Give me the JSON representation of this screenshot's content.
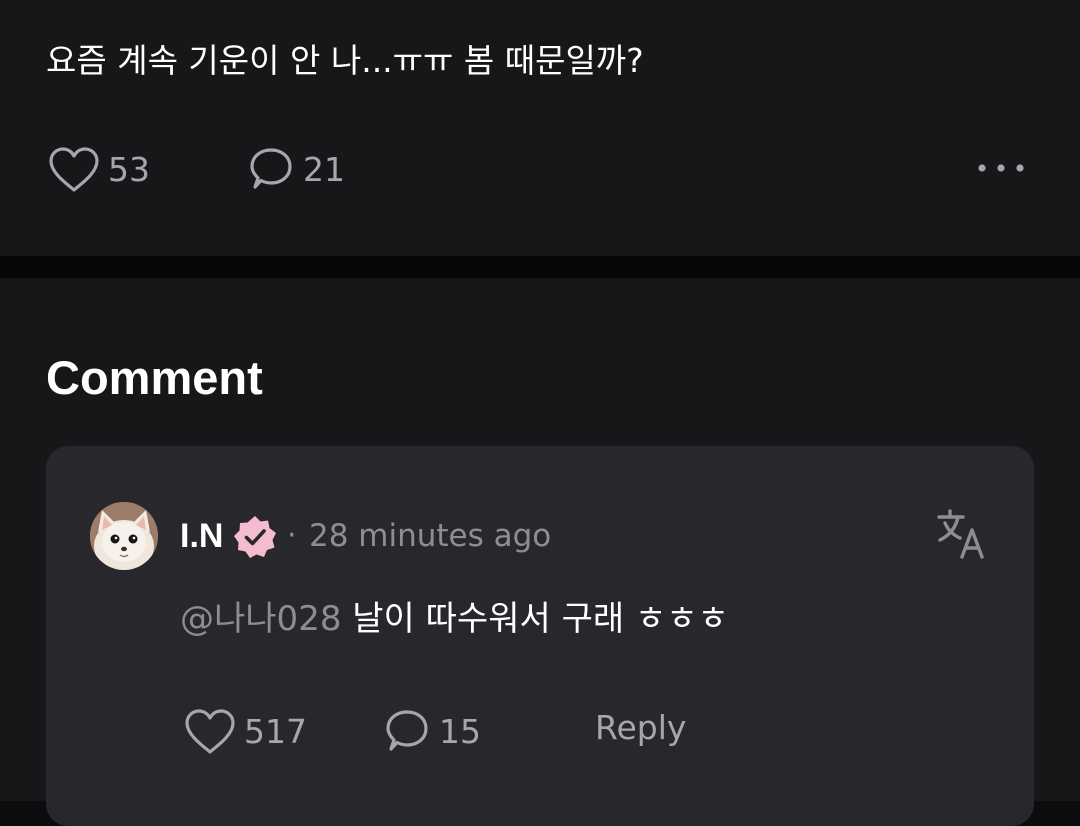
{
  "post": {
    "text": "요즘 계속 기운이 안 나...ㅠㅠ 봄 때문일까?",
    "like_count": "53",
    "comment_count": "21"
  },
  "comments_section": {
    "title": "Comment",
    "comments": [
      {
        "author": "I.N",
        "verified": true,
        "time": "28 minutes ago",
        "mention": "@나나028",
        "text": "날이 따수워서 구래 ㅎㅎㅎ",
        "like_count": "517",
        "reply_count": "15",
        "reply_label": "Reply"
      }
    ]
  },
  "icons": [
    "heart-icon",
    "speech-bubble-icon",
    "more-dots-icon",
    "verified-badge-icon",
    "translate-icon"
  ],
  "colors": {
    "background": "#17171a",
    "divider": "#070708",
    "card": "#27272c",
    "muted_text": "#8d8d93",
    "verified_badge": "#f5bcd0"
  }
}
